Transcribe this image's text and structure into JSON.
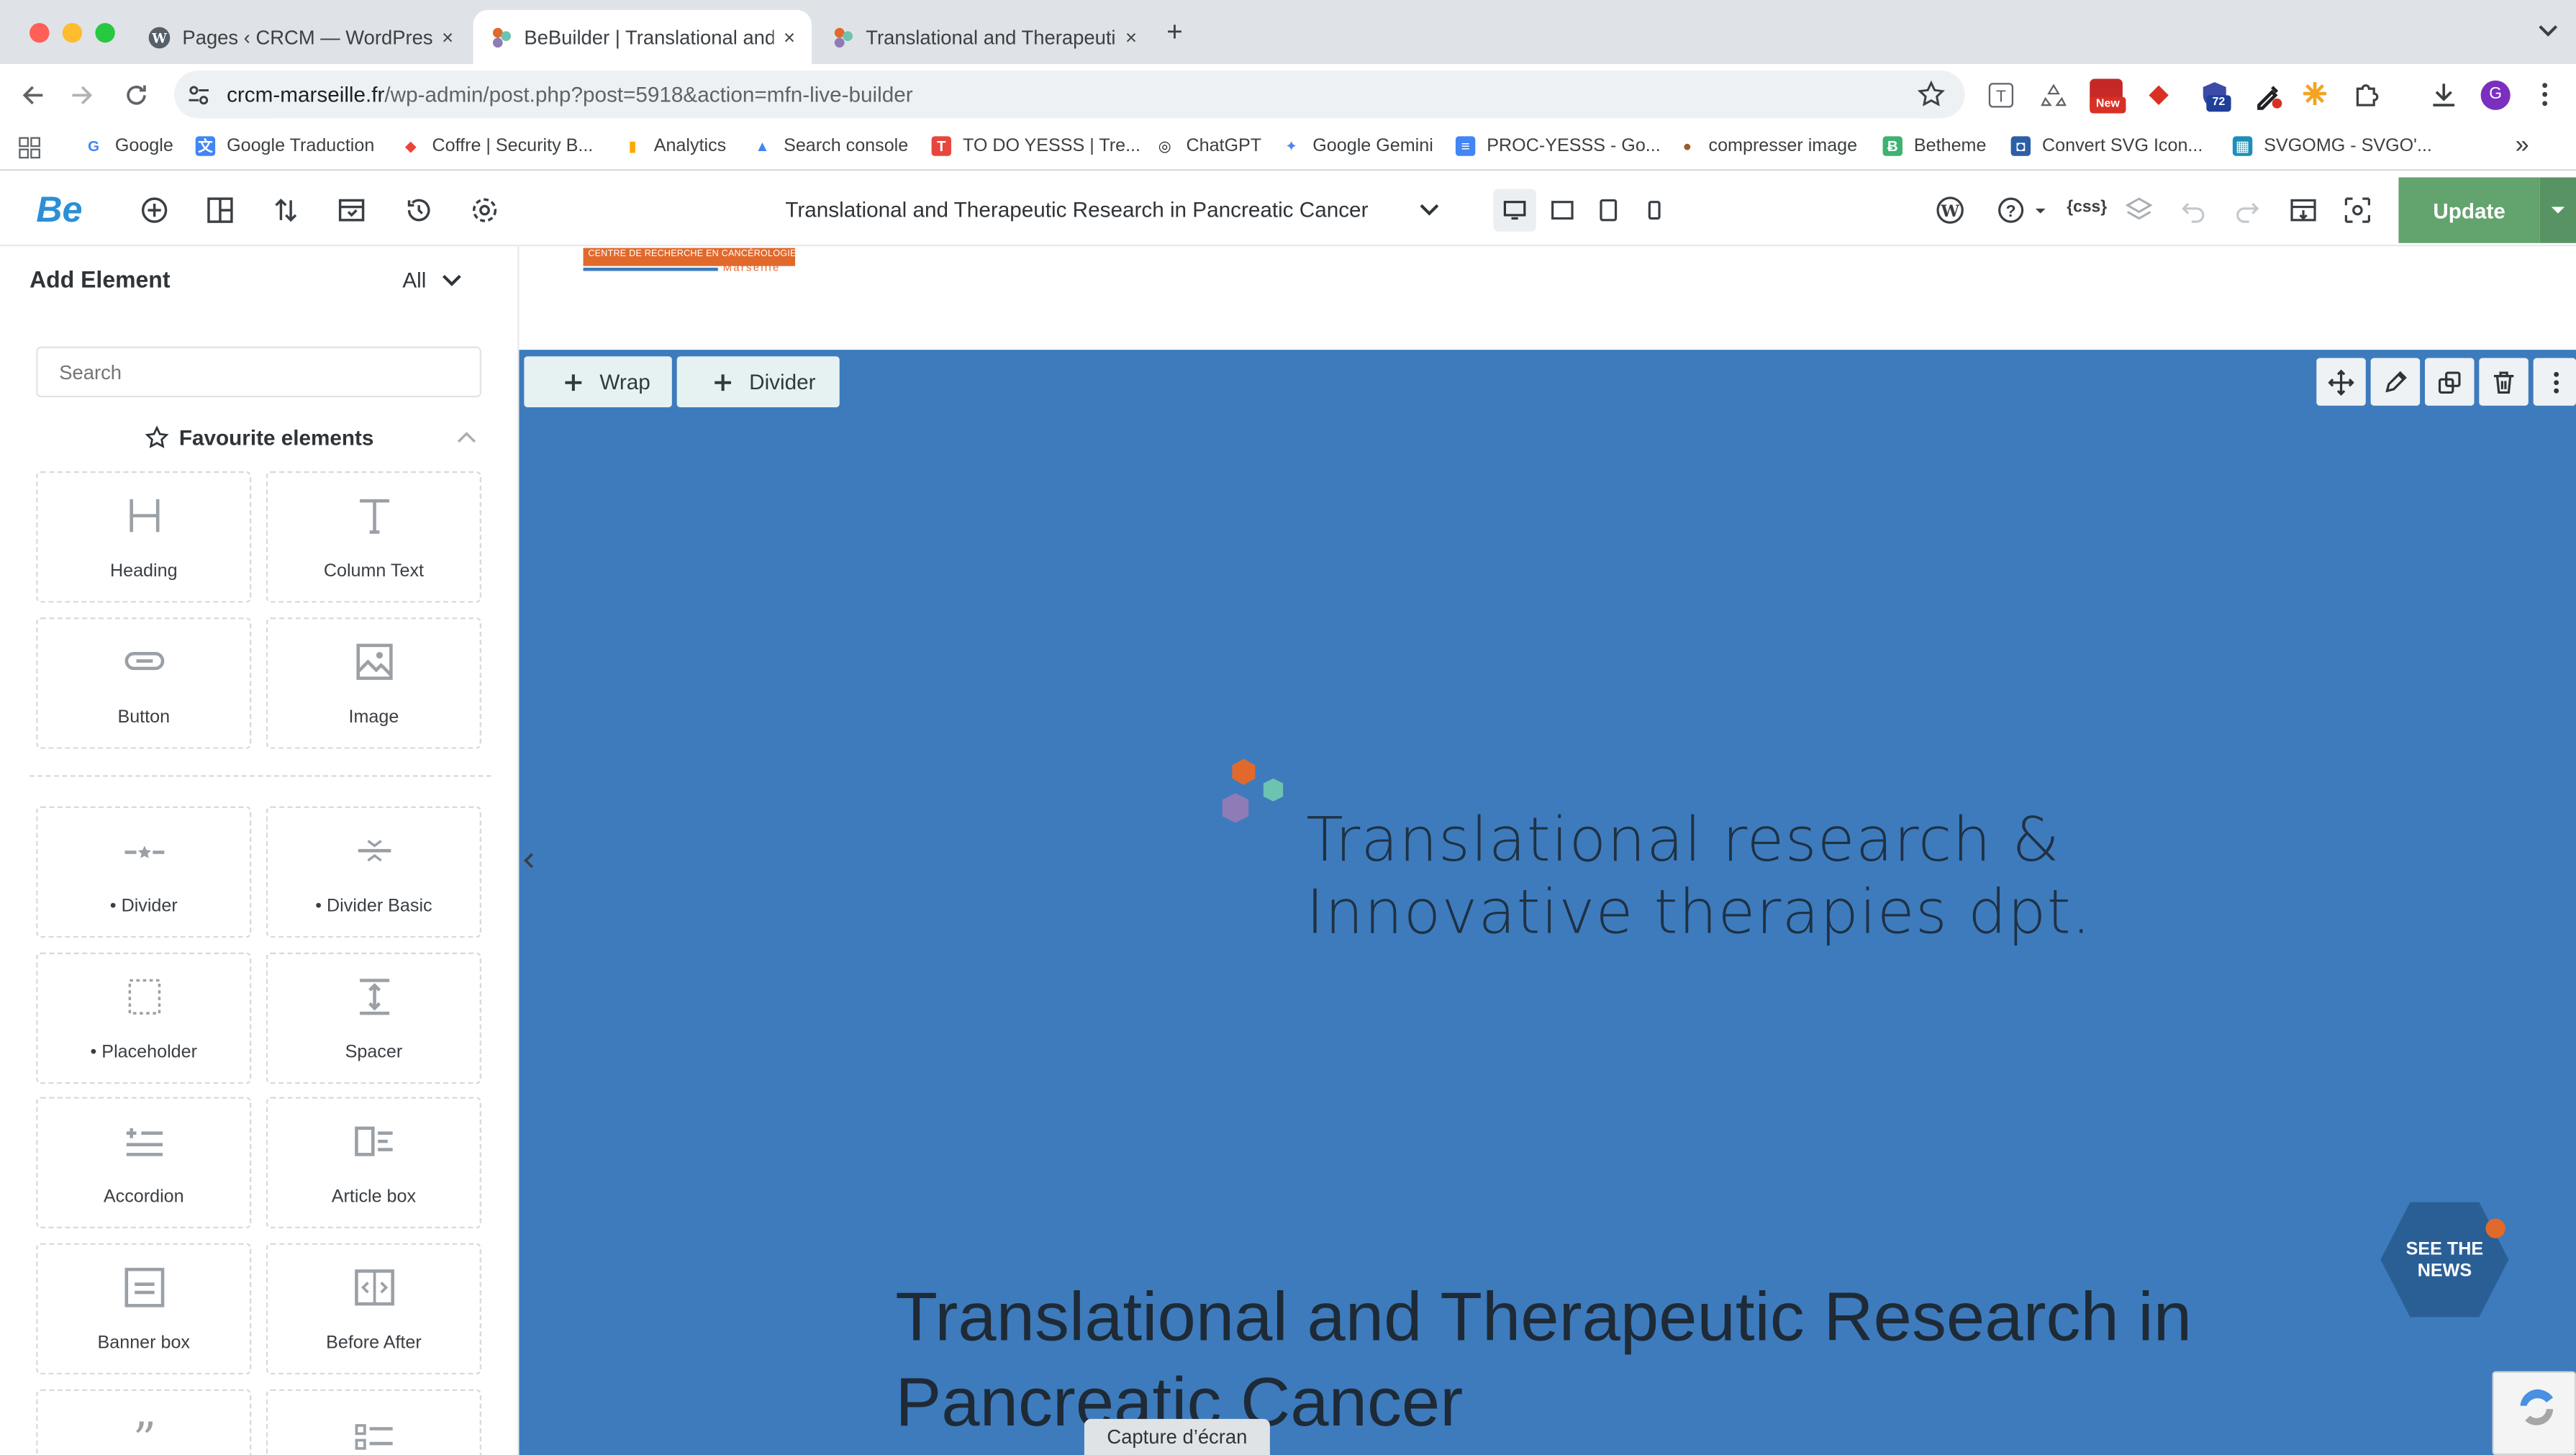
{
  "browser": {
    "tabs": [
      {
        "title": "Pages ‹ CRCM — WordPress",
        "close": "×"
      },
      {
        "title": "BeBuilder | Translational and",
        "close": "×"
      },
      {
        "title": "Translational and Therapeutic",
        "close": "×"
      }
    ],
    "new_tab": "+",
    "url": {
      "host": "crcm-marseille.fr",
      "path": "/wp-admin/post.php?post=5918&action=mfn-live-builder"
    },
    "extension_badges": {
      "new": "New",
      "count": "72"
    },
    "profile_initial": "G",
    "bookmarks": [
      {
        "label": "Google",
        "color": "#4285f4",
        "glyph": "G"
      },
      {
        "label": "Google Traduction",
        "color": "#4285f4",
        "glyph": "文"
      },
      {
        "label": "Coffre | Security B...",
        "color": "#e8453c",
        "glyph": "◆"
      },
      {
        "label": "Analytics",
        "color": "#f9ab00",
        "glyph": "▮"
      },
      {
        "label": "Search console",
        "color": "#4285f4",
        "glyph": "▲"
      },
      {
        "label": "TO DO YESSS | Tre...",
        "color": "#e8453c",
        "glyph": "T"
      },
      {
        "label": "ChatGPT",
        "color": "#202124",
        "glyph": "◎"
      },
      {
        "label": "Google Gemini",
        "color": "#4f86f7",
        "glyph": "✦"
      },
      {
        "label": "PROC-YESSS - Go...",
        "color": "#4285f4",
        "glyph": "≡"
      },
      {
        "label": "compresser image",
        "color": "#9c5c2a",
        "glyph": "●"
      },
      {
        "label": "Betheme",
        "color": "#3cb371",
        "glyph": "Ƀ"
      },
      {
        "label": "Convert SVG Icon...",
        "color": "#2b5fa6",
        "glyph": "◘"
      },
      {
        "label": "SVGOMG - SVGO'...",
        "color": "#1d8fb8",
        "glyph": "▦"
      }
    ],
    "overflow": "»"
  },
  "builder": {
    "logo": "Be",
    "page_title": "Translational and Therapeutic Research in Pancreatic Cancer",
    "update_label": "Update",
    "css_label": "{css}"
  },
  "sidebar": {
    "title": "Add Element",
    "filter": "All",
    "search_placeholder": "Search",
    "favourites_title": "Favourite elements",
    "favourites": [
      {
        "label": "Heading",
        "icon": "heading-icon"
      },
      {
        "label": "Column Text",
        "icon": "text-icon"
      },
      {
        "label": "Button",
        "icon": "button-icon"
      },
      {
        "label": "Image",
        "icon": "image-icon"
      }
    ],
    "elements": [
      {
        "label": "• Divider",
        "icon": "divider-icon"
      },
      {
        "label": "• Divider Basic",
        "icon": "divider-basic-icon"
      },
      {
        "label": "• Placeholder",
        "icon": "placeholder-icon"
      },
      {
        "label": "Spacer",
        "icon": "spacer-icon"
      },
      {
        "label": "Accordion",
        "icon": "accordion-icon"
      },
      {
        "label": "Article box",
        "icon": "article-box-icon"
      },
      {
        "label": "Banner box",
        "icon": "banner-box-icon"
      },
      {
        "label": "Before After",
        "icon": "before-after-icon"
      }
    ]
  },
  "canvas": {
    "org_logo_text": "CENTRE DE RECHERCHE EN CANCÉROLOGIE",
    "org_logo_city": "Marseille",
    "add_buttons": [
      "Wrap",
      "Divider"
    ],
    "hero_line1": "Translational research &",
    "hero_line2": "Innovative therapies dpt.",
    "news_badge_line1": "SEE THE",
    "news_badge_line2": "NEWS",
    "page_heading_line1": "Translational and Therapeutic Research in",
    "page_heading_line2": "Pancreatic Cancer",
    "screenshot_label": "Capture d’écran",
    "colors": {
      "section_bg": "#3d7bbd",
      "accent": "#63a36d",
      "orange": "#e2692c",
      "teal": "#6cc3b0",
      "purple": "#8f7bb6"
    }
  }
}
